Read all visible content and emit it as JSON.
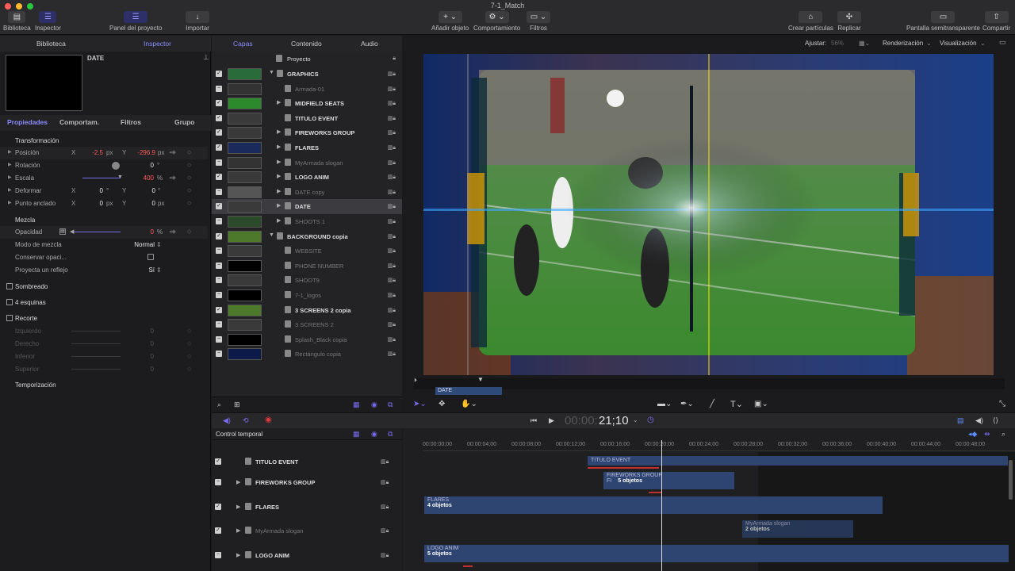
{
  "window": {
    "title": "7-1_Match"
  },
  "toolbar": {
    "library": "Biblioteca",
    "inspector": "Inspector",
    "project_panel": "Panel del proyecto",
    "import": "Importar",
    "add_object": "Añadir objeto",
    "behavior": "Comportamiento",
    "filters": "Filtros",
    "particles": "Crear partículas",
    "replicate": "Replicar",
    "semitransparent": "Pantalla semitransparente",
    "share": "Compartir"
  },
  "left": {
    "tab_library": "Biblioteca",
    "tab_inspector": "Inspector",
    "selected_name": "DATE",
    "subtabs": [
      "Propiedades",
      "Comportam.",
      "Filtros",
      "Grupo"
    ],
    "transform_title": "Transformación",
    "position": {
      "label": "Posición",
      "x_axis": "X",
      "x": "-2.5",
      "x_unit": "px",
      "y_axis": "Y",
      "y": "-296.9",
      "y_unit": "px"
    },
    "rotation": {
      "label": "Rotación",
      "value": "0",
      "unit": "°"
    },
    "scale": {
      "label": "Escala",
      "value": "400",
      "unit": "%"
    },
    "shear": {
      "label": "Deformar",
      "x_axis": "X",
      "x": "0",
      "x_unit": "°",
      "y_axis": "Y",
      "y": "0",
      "y_unit": "°"
    },
    "anchor": {
      "label": "Punto anclado",
      "x_axis": "X",
      "x": "0",
      "x_unit": "px",
      "y_axis": "Y",
      "y": "0",
      "y_unit": "px"
    },
    "blend_title": "Mezcla",
    "opacity": {
      "label": "Opacidad",
      "value": "0",
      "unit": "%"
    },
    "blend_mode": {
      "label": "Modo de mezcla",
      "value": "Normal"
    },
    "preserve": {
      "label": "Conservar opaci..."
    },
    "reflect": {
      "label": "Proyecta un reflejo",
      "value": "Sí"
    },
    "shadow": "Sombreado",
    "corners": "4 esquinas",
    "crop": "Recorte",
    "crop_rows": [
      {
        "label": "Izquierdo",
        "value": "0"
      },
      {
        "label": "Derecho",
        "value": "0"
      },
      {
        "label": "Inferior",
        "value": "0"
      },
      {
        "label": "Superior",
        "value": "0"
      }
    ],
    "timing": "Temporización"
  },
  "layers": {
    "tabs": [
      "Capas",
      "Contenido",
      "Audio"
    ],
    "project": "Proyecto",
    "items": [
      {
        "name": "GRAPHICS",
        "dim": false,
        "indent": 0
      },
      {
        "name": "Armada-01",
        "dim": true,
        "indent": 1
      },
      {
        "name": "MIDFIELD SEATS",
        "dim": false,
        "indent": 1
      },
      {
        "name": "TITULO EVENT",
        "dim": false,
        "indent": 1
      },
      {
        "name": "FIREWORKS GROUP",
        "dim": false,
        "indent": 1
      },
      {
        "name": "FLARES",
        "dim": false,
        "indent": 1
      },
      {
        "name": "MyArmada slogan",
        "dim": true,
        "indent": 1
      },
      {
        "name": "LOGO ANIM",
        "dim": false,
        "indent": 1
      },
      {
        "name": "DATE copy",
        "dim": true,
        "indent": 1
      },
      {
        "name": "DATE",
        "dim": false,
        "indent": 1
      },
      {
        "name": "SHOOTS 1",
        "dim": true,
        "indent": 1
      },
      {
        "name": "BACKGROUND copia",
        "dim": false,
        "indent": 0
      },
      {
        "name": "WEBSITE",
        "dim": true,
        "indent": 1
      },
      {
        "name": "PHONE NUMBER",
        "dim": true,
        "indent": 1
      },
      {
        "name": "SHOOT9",
        "dim": true,
        "indent": 1
      },
      {
        "name": "7-1_logos",
        "dim": true,
        "indent": 1
      },
      {
        "name": "3 SCREENS 2 copia",
        "dim": false,
        "indent": 1
      },
      {
        "name": "3 SCREENS 2",
        "dim": true,
        "indent": 1
      },
      {
        "name": "Splash_Black copia",
        "dim": true,
        "indent": 1
      },
      {
        "name": "Rectángulo copia",
        "dim": true,
        "indent": 1
      }
    ]
  },
  "canvas": {
    "fit_label": "Ajustar:",
    "fit_value": "56%",
    "render": "Renderización",
    "view": "Visualización",
    "mini_label": "DATE"
  },
  "transport": {
    "timecode_dim": "00:00:",
    "timecode": "21;10"
  },
  "timeline": {
    "title": "Control temporal",
    "ruler": [
      "00:00:00;00",
      "00:00:04;00",
      "00:00:08;00",
      "00:00:12;00",
      "00:00:16;00",
      "00:00:20;00",
      "00:00:24;00",
      "00:00:28;00",
      "00:00:32;00",
      "00:00:36;00",
      "00:00:40;00",
      "00:00:44;00",
      "00:00:48;00"
    ],
    "tracks": [
      {
        "name": "TITULO EVENT",
        "dim": false
      },
      {
        "name": "FIREWORKS GROUP",
        "dim": false
      },
      {
        "name": "FLARES",
        "dim": false
      },
      {
        "name": "MyArmada slogan",
        "dim": true
      },
      {
        "name": "LOGO ANIM",
        "dim": false
      }
    ],
    "clips": {
      "titulo": "TITULO EVENT",
      "fireworks": "FIREWORKS GROUP",
      "fireworks_count": "5 objetos",
      "flares": "FLARES",
      "flares_count": "4 objetos",
      "slogan": "MyArmada slogan",
      "slogan_count": "2 objetos",
      "logo": "LOGO ANIM",
      "logo_count": "5 objetos",
      "fi": "FI"
    }
  }
}
